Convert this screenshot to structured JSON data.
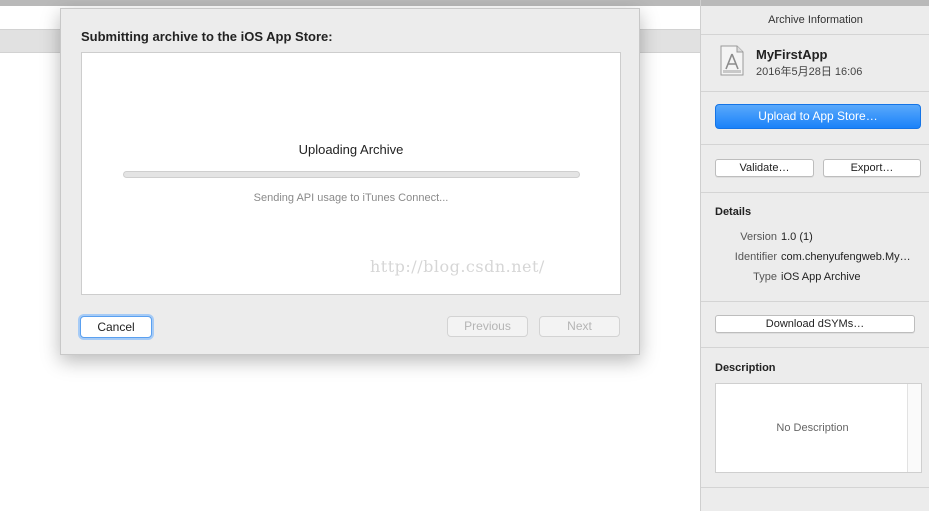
{
  "sheet": {
    "title": "Submitting archive to the iOS App Store:",
    "upload_title": "Uploading Archive",
    "status": "Sending API usage to iTunes Connect...",
    "watermark": "http://blog.csdn.net/",
    "progress_fraction": 0.0,
    "cancel_label": "Cancel",
    "previous_label": "Previous",
    "next_label": "Next"
  },
  "inspector": {
    "header": "Archive Information",
    "app_name": "MyFirstApp",
    "app_date": "2016年5月28日 16:06",
    "upload_label": "Upload to App Store…",
    "validate_label": "Validate…",
    "export_label": "Export…",
    "details_title": "Details",
    "details": [
      {
        "key": "Version",
        "value": "1.0 (1)"
      },
      {
        "key": "Identifier",
        "value": "com.chenyufengweb.My…"
      },
      {
        "key": "Type",
        "value": "iOS App Archive"
      }
    ],
    "download_dsyms_label": "Download dSYMs…",
    "description_title": "Description",
    "description_text": "No Description",
    "app_icon": "archive-document-icon",
    "accent_color": "#1a82f9"
  }
}
